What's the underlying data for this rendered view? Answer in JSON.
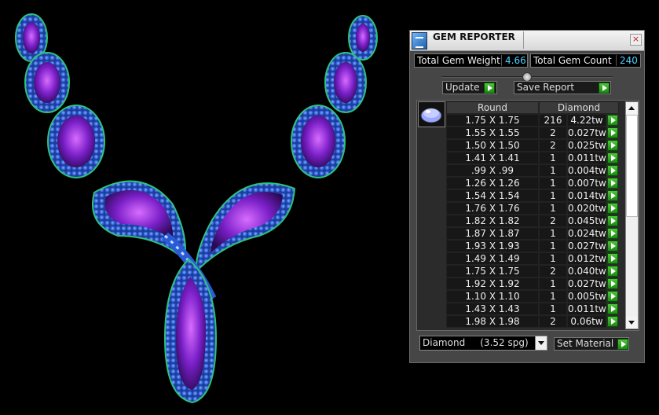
{
  "window": {
    "title": "GEM REPORTER",
    "close_label": "×"
  },
  "stats": {
    "total_weight_label": "Total Gem Weight",
    "total_weight_value": "4.66",
    "total_count_label": "Total Gem Count",
    "total_count_value": "240"
  },
  "buttons": {
    "update_label": "Update",
    "save_report_label": "Save Report",
    "set_material_label": "Set Material"
  },
  "table": {
    "col_shape": "Round",
    "col_material": "Diamond",
    "rows": [
      {
        "size": "1.75 X 1.75",
        "count": "216",
        "weight": "4.22tw"
      },
      {
        "size": "1.55 X 1.55",
        "count": "2",
        "weight": "0.027tw"
      },
      {
        "size": "1.50 X 1.50",
        "count": "2",
        "weight": "0.025tw"
      },
      {
        "size": "1.41 X 1.41",
        "count": "1",
        "weight": "0.011tw"
      },
      {
        "size": ".99 X .99",
        "count": "1",
        "weight": "0.004tw"
      },
      {
        "size": "1.26 X 1.26",
        "count": "1",
        "weight": "0.007tw"
      },
      {
        "size": "1.54 X 1.54",
        "count": "1",
        "weight": "0.014tw"
      },
      {
        "size": "1.76 X 1.76",
        "count": "1",
        "weight": "0.020tw"
      },
      {
        "size": "1.82 X 1.82",
        "count": "2",
        "weight": "0.045tw"
      },
      {
        "size": "1.87 X 1.87",
        "count": "1",
        "weight": "0.024tw"
      },
      {
        "size": "1.93 X 1.93",
        "count": "1",
        "weight": "0.027tw"
      },
      {
        "size": "1.49 X 1.49",
        "count": "1",
        "weight": "0.012tw"
      },
      {
        "size": "1.75 X 1.75",
        "count": "2",
        "weight": "0.040tw"
      },
      {
        "size": "1.92 X 1.92",
        "count": "1",
        "weight": "0.027tw"
      },
      {
        "size": "1.10 X 1.10",
        "count": "1",
        "weight": "0.005tw"
      },
      {
        "size": "1.43 X 1.43",
        "count": "1",
        "weight": "0.011tw"
      },
      {
        "size": "1.98 X 1.98",
        "count": "2",
        "weight": "0.06tw"
      }
    ]
  },
  "material_select": {
    "value": "Diamond     (3.52 spg)"
  },
  "colors": {
    "value_text": "#4fd0ff",
    "arrow_green": "#2fa822",
    "gem_purple": "#8a2be2",
    "gem_blue": "#2a5bd7",
    "metal_green": "#2ec27e"
  }
}
